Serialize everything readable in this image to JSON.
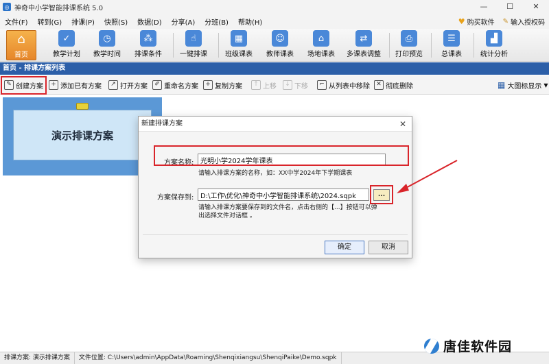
{
  "window": {
    "title": "神奇中小学智能排课系统 5.0",
    "controls": [
      "—",
      "☐",
      "✕"
    ]
  },
  "menu": {
    "items": [
      "文件(F)",
      "转到(G)",
      "排课(P)",
      "快照(S)",
      "数据(D)",
      "分享(A)",
      "分班(B)",
      "帮助(H)"
    ],
    "buy_label": "购买软件",
    "license_label": "输入授权码"
  },
  "toolbar": {
    "items": [
      {
        "label": "首页",
        "icon": "home-icon"
      },
      {
        "label": "教学计划",
        "icon": "clipboard-icon"
      },
      {
        "label": "教学时间",
        "icon": "clock-icon"
      },
      {
        "label": "排课条件",
        "icon": "conditions-icon"
      },
      {
        "label": "一键排课",
        "icon": "click-icon"
      },
      {
        "label": "班级课表",
        "icon": "calendar-icon"
      },
      {
        "label": "教师课表",
        "icon": "teacher-icon"
      },
      {
        "label": "场地课表",
        "icon": "building-icon"
      },
      {
        "label": "多课表调整",
        "icon": "adjust-icon"
      },
      {
        "label": "打印预览",
        "icon": "printer-icon"
      },
      {
        "label": "总课表",
        "icon": "schedule-icon"
      },
      {
        "label": "统计分析",
        "icon": "chart-icon"
      }
    ]
  },
  "breadcrumb": "首页 - 排课方案列表",
  "subtoolbar": {
    "create": "创建方案",
    "add_existing": "添加已有方案",
    "open": "打开方案",
    "rename": "重命名方案",
    "copy": "复制方案",
    "move_up": "上移",
    "move_down": "下移",
    "remove_from_list": "从列表中移除",
    "delete": "彻底删除",
    "view_mode": "大图标显示"
  },
  "plan_card": {
    "title": "演示排课方案"
  },
  "dialog": {
    "title": "新建排课方案",
    "name_label": "方案名称:",
    "name_value": "光明小学2024学年课表",
    "name_hint": "请输入排课方案的名称，如：XX中学2024年下学期课表",
    "path_label": "方案保存到:",
    "path_value": "D:\\工作\\优化\\神奇中小学智能排课系统\\2024.sqpk",
    "browse_label": "...",
    "path_hint_1": "请输入排课方案要保存到的文件名，点击右侧的【...】按钮可以弹",
    "path_hint_2": "出选择文件对话框 。",
    "ok_label": "确定",
    "cancel_label": "取消"
  },
  "statusbar": {
    "plan": "排课方案: 演示排课方案",
    "file": "文件位置: C:\\Users\\admin\\AppData\\Roaming\\Shenqixiangsu\\ShenqiPaike\\Demo.sqpk"
  },
  "watermark": {
    "text": "唐佳软件园"
  },
  "colors": {
    "accent": "#2c5fa8",
    "highlight_red": "#d9242a",
    "active_tab": "#e6862a",
    "card_blue": "#5b98d6"
  }
}
